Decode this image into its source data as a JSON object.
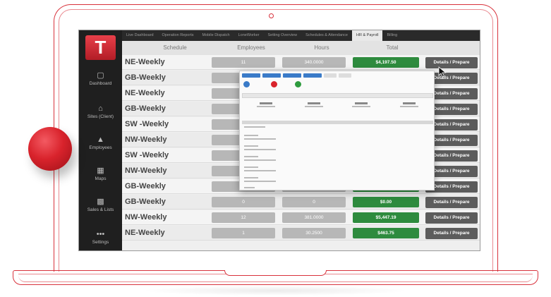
{
  "app": {
    "logo_text": "T",
    "brand_color": "#d8323c"
  },
  "tabs": [
    {
      "label": "Live Dashboard",
      "active": false
    },
    {
      "label": "Operation Reports",
      "active": false
    },
    {
      "label": "Mobile Dispatch",
      "active": false
    },
    {
      "label": "LoneWorker",
      "active": false
    },
    {
      "label": "Setting Overview",
      "active": false
    },
    {
      "label": "Schedules & Attendance",
      "active": false
    },
    {
      "label": "HR & Payroll",
      "active": true
    },
    {
      "label": "Billing",
      "active": false
    }
  ],
  "sidebar": {
    "items": [
      {
        "label": "Dashboard",
        "icon": "monitor-icon"
      },
      {
        "label": "Sites (Client)",
        "icon": "building-icon"
      },
      {
        "label": "Employees",
        "icon": "person-icon"
      },
      {
        "label": "Maps",
        "icon": "map-icon"
      },
      {
        "label": "Sales & Lists",
        "icon": "chart-icon"
      },
      {
        "label": "Settings",
        "icon": "dots-icon"
      }
    ]
  },
  "table": {
    "headers": {
      "schedule": "Schedule",
      "employees": "Employees",
      "hours": "Hours",
      "total": "Total"
    },
    "rows": [
      {
        "schedule": "NE-Weekly",
        "employees": "11",
        "hours": "340.0000",
        "total": "$4,197.50",
        "action": "Details / Prepare"
      },
      {
        "schedule": "GB-Weekly",
        "employees": "",
        "hours": "",
        "total": "",
        "action": "Details / Prepare"
      },
      {
        "schedule": "NE-Weekly",
        "employees": "",
        "hours": "",
        "total": "",
        "action": "Details / Prepare"
      },
      {
        "schedule": "GB-Weekly",
        "employees": "",
        "hours": "",
        "total": "",
        "action": "Details / Prepare"
      },
      {
        "schedule": "SW -Weekly",
        "employees": "",
        "hours": "",
        "total": "",
        "action": "Details / Prepare"
      },
      {
        "schedule": "NW-Weekly",
        "employees": "",
        "hours": "",
        "total": "",
        "action": "Details / Prepare"
      },
      {
        "schedule": "SW -Weekly",
        "employees": "",
        "hours": "",
        "total": "",
        "action": "Details / Prepare"
      },
      {
        "schedule": "NW-Weekly",
        "employees": "",
        "hours": "",
        "total": "",
        "action": "Details / Prepare"
      },
      {
        "schedule": "GB-Weekly",
        "employees": "",
        "hours": "",
        "total": "",
        "action": "Details / Prepare"
      },
      {
        "schedule": "GB-Weekly",
        "employees": "0",
        "hours": "0",
        "total": "$0.00",
        "action": "Details / Prepare"
      },
      {
        "schedule": "NW-Weekly",
        "employees": "12",
        "hours": "381.0000",
        "total": "$5,447.19",
        "action": "Details / Prepare"
      },
      {
        "schedule": "NE-Weekly",
        "employees": "1",
        "hours": "30.2500",
        "total": "$463.75",
        "action": "Details / Prepare"
      }
    ]
  },
  "colors": {
    "total_green": "#2e8b3e",
    "button_grey": "#5c5c5c",
    "sidebar_bg": "#1f1f1f"
  }
}
